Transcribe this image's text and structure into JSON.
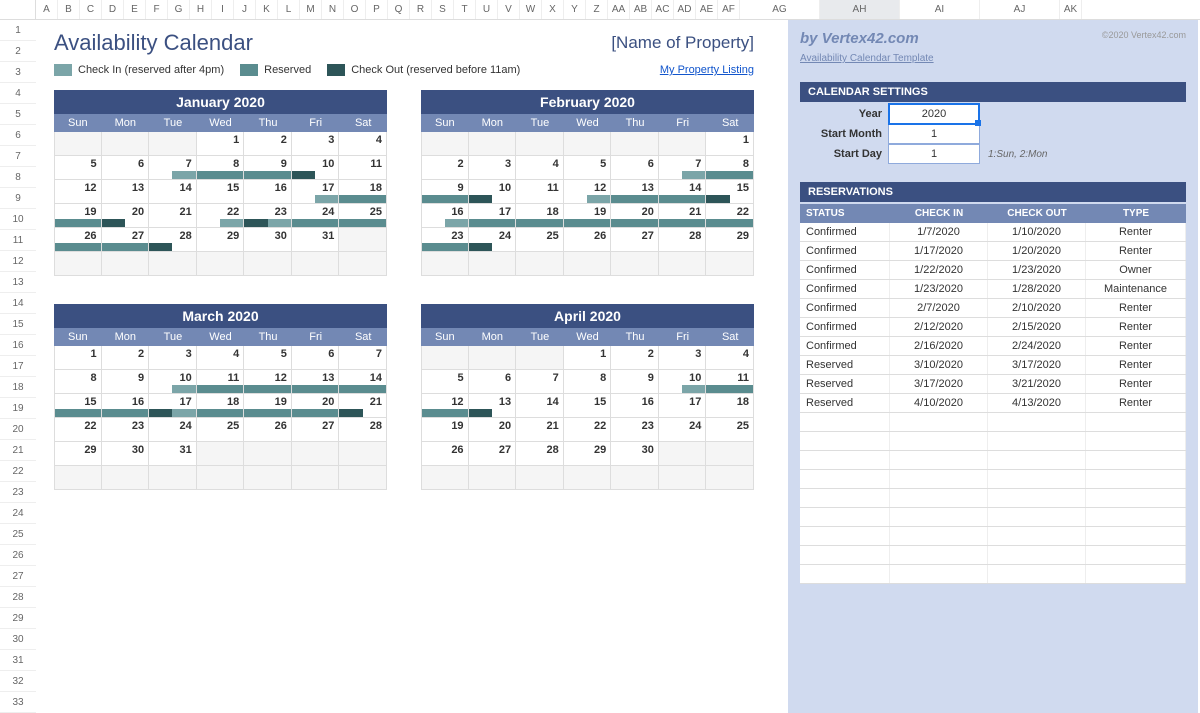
{
  "colHeaders": [
    "A",
    "B",
    "C",
    "D",
    "E",
    "F",
    "G",
    "H",
    "I",
    "J",
    "K",
    "L",
    "M",
    "N",
    "O",
    "P",
    "Q",
    "R",
    "S",
    "T",
    "U",
    "V",
    "W",
    "X",
    "Y",
    "Z",
    "AA",
    "AB",
    "AC",
    "AD",
    "AE",
    "AF",
    "AG",
    "AH",
    "AI",
    "AJ",
    "AK"
  ],
  "title": "Availability Calendar",
  "propertyName": "[Name of Property]",
  "legend": {
    "checkin": "Check In (reserved after 4pm)",
    "reserved": "Reserved",
    "checkout": "Check Out (reserved before 11am)"
  },
  "listingLink": "My Property Listing",
  "dow": [
    "Sun",
    "Mon",
    "Tue",
    "Wed",
    "Thu",
    "Fri",
    "Sat"
  ],
  "months": [
    {
      "name": "January 2020",
      "start": 3,
      "days": 31,
      "bars": {
        "7": "ci",
        "8": "r",
        "9": "r",
        "10": "co",
        "17": "ci",
        "18": "r",
        "19": "r",
        "20": "co",
        "22": "ci",
        "23": "ci-co",
        "24": "r",
        "25": "r",
        "26": "r",
        "27": "r",
        "28": "co"
      }
    },
    {
      "name": "February 2020",
      "start": 6,
      "days": 29,
      "bars": {
        "7": "ci",
        "8": "r",
        "9": "r",
        "10": "co",
        "12": "ci",
        "13": "r",
        "14": "r",
        "15": "co",
        "16": "ci",
        "17": "r",
        "18": "r",
        "19": "r",
        "20": "r",
        "21": "r",
        "22": "r",
        "23": "r",
        "24": "co"
      }
    },
    {
      "name": "March 2020",
      "start": 0,
      "days": 31,
      "bars": {
        "10": "ci",
        "11": "r",
        "12": "r",
        "13": "r",
        "14": "r",
        "15": "r",
        "16": "r",
        "17": "ci-co",
        "18": "r",
        "19": "r",
        "20": "r",
        "21": "co"
      }
    },
    {
      "name": "April 2020",
      "start": 3,
      "days": 30,
      "bars": {
        "10": "ci",
        "11": "r",
        "12": "r",
        "13": "co"
      }
    }
  ],
  "brand": "by Vertex42.com",
  "copyright": "©2020 Vertex42.com",
  "templateLink": "Availability Calendar Template",
  "settingsHeader": "CALENDAR SETTINGS",
  "settings": {
    "yearLabel": "Year",
    "yearValue": "2020",
    "startMonthLabel": "Start Month",
    "startMonthValue": "1",
    "startDayLabel": "Start Day",
    "startDayValue": "1",
    "startDayHint": "1:Sun, 2:Mon"
  },
  "reservationsHeader": "RESERVATIONS",
  "resCols": {
    "status": "STATUS",
    "checkin": "CHECK IN",
    "checkout": "CHECK OUT",
    "type": "TYPE"
  },
  "reservations": [
    {
      "status": "Confirmed",
      "in": "1/7/2020",
      "out": "1/10/2020",
      "type": "Renter"
    },
    {
      "status": "Confirmed",
      "in": "1/17/2020",
      "out": "1/20/2020",
      "type": "Renter"
    },
    {
      "status": "Confirmed",
      "in": "1/22/2020",
      "out": "1/23/2020",
      "type": "Owner"
    },
    {
      "status": "Confirmed",
      "in": "1/23/2020",
      "out": "1/28/2020",
      "type": "Maintenance"
    },
    {
      "status": "Confirmed",
      "in": "2/7/2020",
      "out": "2/10/2020",
      "type": "Renter"
    },
    {
      "status": "Confirmed",
      "in": "2/12/2020",
      "out": "2/15/2020",
      "type": "Renter"
    },
    {
      "status": "Confirmed",
      "in": "2/16/2020",
      "out": "2/24/2020",
      "type": "Renter"
    },
    {
      "status": "Reserved",
      "in": "3/10/2020",
      "out": "3/17/2020",
      "type": "Renter"
    },
    {
      "status": "Reserved",
      "in": "3/17/2020",
      "out": "3/21/2020",
      "type": "Renter"
    },
    {
      "status": "Reserved",
      "in": "4/10/2020",
      "out": "4/13/2020",
      "type": "Renter"
    }
  ],
  "emptyResRows": 9,
  "selectedColumn": "AH"
}
